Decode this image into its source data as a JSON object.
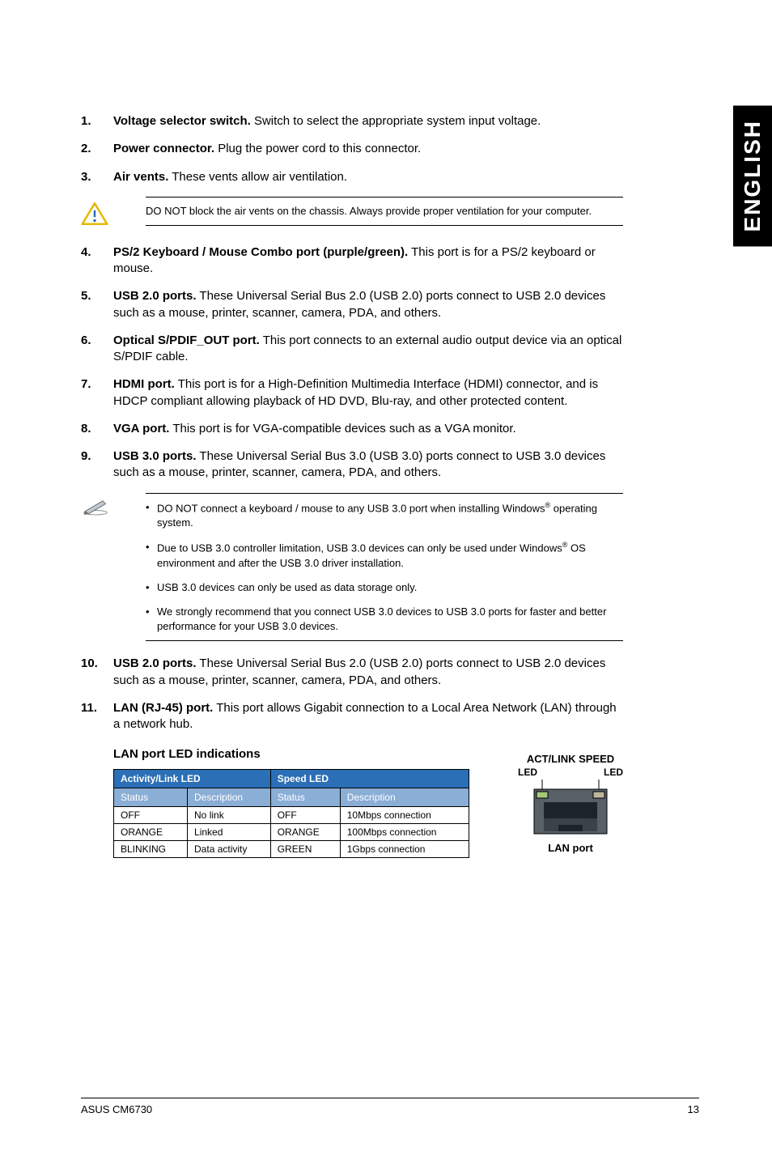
{
  "side_tab": "ENGLISH",
  "items": [
    {
      "num": "1.",
      "bold": "Voltage selector switch.",
      "rest": " Switch to select the appropriate system input voltage."
    },
    {
      "num": "2.",
      "bold": "Power connector.",
      "rest": " Plug the power cord to this connector."
    },
    {
      "num": "3.",
      "bold": "Air vents.",
      "rest": " These vents allow air ventilation."
    }
  ],
  "warning1": "DO NOT block the air vents on the chassis. Always provide proper ventilation for your computer.",
  "items2": [
    {
      "num": "4.",
      "bold": "PS/2 Keyboard / Mouse Combo port (purple/green).",
      "rest": " This port is for a PS/2 keyboard or mouse."
    },
    {
      "num": "5.",
      "bold": "USB 2.0 ports.",
      "rest": " These Universal Serial Bus 2.0 (USB 2.0) ports connect to USB 2.0 devices such as a mouse, printer, scanner, camera, PDA, and others."
    },
    {
      "num": "6.",
      "bold": "Optical S/PDIF_OUT port.",
      "rest": " This port connects to an external audio output device via an optical S/PDIF cable."
    },
    {
      "num": "7.",
      "bold": "HDMI port.",
      "rest": " This port is for a High-Definition Multimedia Interface (HDMI) connector, and is HDCP compliant allowing playback of HD DVD, Blu-ray, and other protected content."
    },
    {
      "num": "8.",
      "bold": "VGA port.",
      "rest": " This port is for VGA-compatible devices such as a VGA monitor."
    },
    {
      "num": "9.",
      "bold": "USB 3.0 ports.",
      "rest": " These Universal Serial Bus 3.0 (USB 3.0) ports connect to USB 3.0 devices such as a mouse, printer, scanner, camera, PDA, and others."
    }
  ],
  "note2": {
    "b1a": "DO NOT connect a keyboard / mouse to any USB 3.0 port when installing Windows",
    "b1b": " operating system.",
    "b2a": "Due to USB 3.0 controller limitation, USB 3.0 devices can only be used under Windows",
    "b2b": " OS environment and after the USB 3.0 driver installation.",
    "b3": "USB 3.0 devices can only be used as data storage only.",
    "b4": "We strongly recommend that you connect USB 3.0 devices to USB 3.0 ports for faster and better performance for your USB 3.0 devices."
  },
  "items3": [
    {
      "num": "10.",
      "bold": "USB 2.0 ports.",
      "rest": " These Universal Serial Bus 2.0 (USB 2.0) ports connect to USB 2.0 devices such as a mouse, printer, scanner, camera, PDA, and others."
    },
    {
      "num": "11.",
      "bold": "LAN (RJ-45) port.",
      "rest": " This port allows Gigabit connection to a Local Area Network (LAN) through a network hub."
    }
  ],
  "lan_section_label": "LAN port LED indications",
  "table": {
    "group1": "Activity/Link LED",
    "group2": "Speed LED",
    "sub_status": "Status",
    "sub_desc": "Description",
    "rows": [
      {
        "s1": "OFF",
        "d1": "No link",
        "s2": "OFF",
        "d2": "10Mbps connection"
      },
      {
        "s1": "ORANGE",
        "d1": "Linked",
        "s2": "ORANGE",
        "d2": "100Mbps connection"
      },
      {
        "s1": "BLINKING",
        "d1": "Data activity",
        "s2": "GREEN",
        "d2": "1Gbps connection"
      }
    ]
  },
  "diagram": {
    "title_line1": "ACT/LINK",
    "title_line2": "SPEED",
    "led_left": "LED",
    "led_right": "LED",
    "caption": "LAN port"
  },
  "footer": {
    "left": "ASUS CM6730",
    "right": "13"
  },
  "reg": "®"
}
